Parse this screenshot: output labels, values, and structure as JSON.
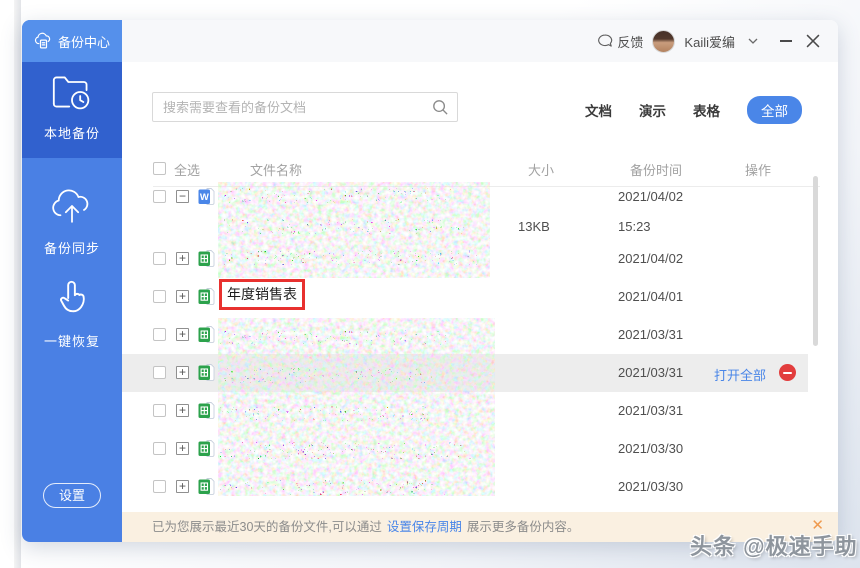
{
  "titlebar": {
    "feedback_label": "反馈",
    "username": "Kaili爱编"
  },
  "sidebar": {
    "header_label": "备份中心",
    "items": [
      {
        "label": "本地备份",
        "active": true
      },
      {
        "label": "备份同步",
        "active": false
      },
      {
        "label": "一键恢复",
        "active": false
      }
    ],
    "settings_label": "设置"
  },
  "toolbar": {
    "search_placeholder": "搜索需要查看的备份文档",
    "filters": [
      {
        "label": "文档",
        "active": false
      },
      {
        "label": "演示",
        "active": false
      },
      {
        "label": "表格",
        "active": false
      },
      {
        "label": "全部",
        "active": true
      }
    ]
  },
  "table": {
    "select_all_label": "全选",
    "columns": {
      "name": "文件名称",
      "size": "大小",
      "time": "备份时间",
      "action": "操作"
    },
    "rows": [
      {
        "file_type": "word",
        "name_censored": true,
        "date": "2021/04/02",
        "expanded": true
      },
      {
        "file_type": "sheet",
        "name_censored": true,
        "date": "2021/04/02"
      },
      {
        "file_type": "sheet",
        "name": "年度销售表",
        "date": "2021/04/01",
        "red_box": true
      },
      {
        "file_type": "sheet",
        "name_censored": true,
        "date": "2021/03/31"
      },
      {
        "file_type": "sheet",
        "name_censored": true,
        "date": "2021/03/31",
        "action_label": "打开全部",
        "hovered": true
      },
      {
        "file_type": "sheet",
        "name_censored": true,
        "date": "2021/03/31"
      },
      {
        "file_type": "sheet",
        "name_censored": true,
        "date": "2021/03/30"
      },
      {
        "file_type": "sheet",
        "name_censored": true,
        "date": "2021/03/30"
      }
    ],
    "expanded_version": {
      "size": "13KB",
      "time": "15:23"
    }
  },
  "notice": {
    "text_before": "已为您展示最近30天的备份文件,可以通过",
    "link": "设置保存周期",
    "text_after": "展示更多备份内容。"
  },
  "watermark": "头条 @极速手助",
  "colors": {
    "accent": "#4a86e8",
    "sidebar": "#4a80e4",
    "sidebar_header": "#5590eb",
    "sidebar_active": "#3161ce",
    "danger": "#e23d3d",
    "red_box_border": "#e8312f",
    "notice_bg": "#faf0e1",
    "word_icon": "#4a86e8",
    "sheet_icon": "#2ca24c"
  }
}
